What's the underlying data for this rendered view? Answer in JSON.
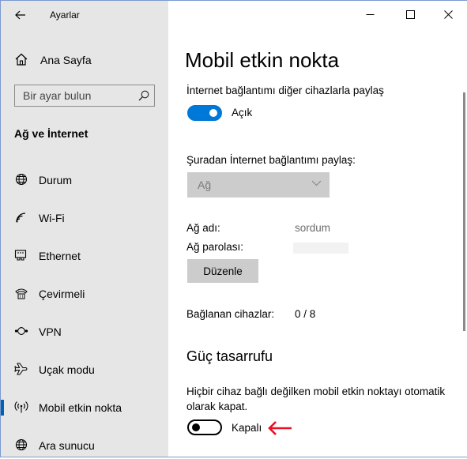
{
  "window": {
    "title": "Ayarlar"
  },
  "sidebar": {
    "home_label": "Ana Sayfa",
    "search_placeholder": "Bir ayar bulun",
    "section_title": "Ağ ve İnternet",
    "items": [
      {
        "label": "Durum",
        "icon": "globe-icon"
      },
      {
        "label": "Wi-Fi",
        "icon": "wifi-icon"
      },
      {
        "label": "Ethernet",
        "icon": "ethernet-icon"
      },
      {
        "label": "Çevirmeli",
        "icon": "dialup-icon"
      },
      {
        "label": "VPN",
        "icon": "vpn-icon"
      },
      {
        "label": "Uçak modu",
        "icon": "airplane-icon"
      },
      {
        "label": "Mobil etkin nokta",
        "icon": "hotspot-icon",
        "active": true
      },
      {
        "label": "Ara sunucu",
        "icon": "globe-icon"
      }
    ]
  },
  "main": {
    "title": "Mobil etkin nokta",
    "share_label": "İnternet bağlantımı diğer cihazlarla paylaş",
    "share_toggle_state": "Açık",
    "share_from_label": "Şuradan İnternet bağlantımı paylaş:",
    "share_from_value": "Ağ",
    "network_name_label": "Ağ adı:",
    "network_name_value": "sordum",
    "network_password_label": "Ağ parolası:",
    "edit_button": "Düzenle",
    "connected_devices_label": "Bağlanan cihazlar:",
    "connected_devices_value": "0 / 8",
    "power_saving_title": "Güç tasarrufu",
    "power_saving_desc": "Hiçbir cihaz bağlı değilken mobil etkin noktayı otomatik olarak kapat.",
    "power_saving_toggle_state": "Kapalı"
  },
  "colors": {
    "accent": "#0078d7",
    "annotation_arrow": "#e81123",
    "sidebar_bg": "#e6e6e6"
  }
}
